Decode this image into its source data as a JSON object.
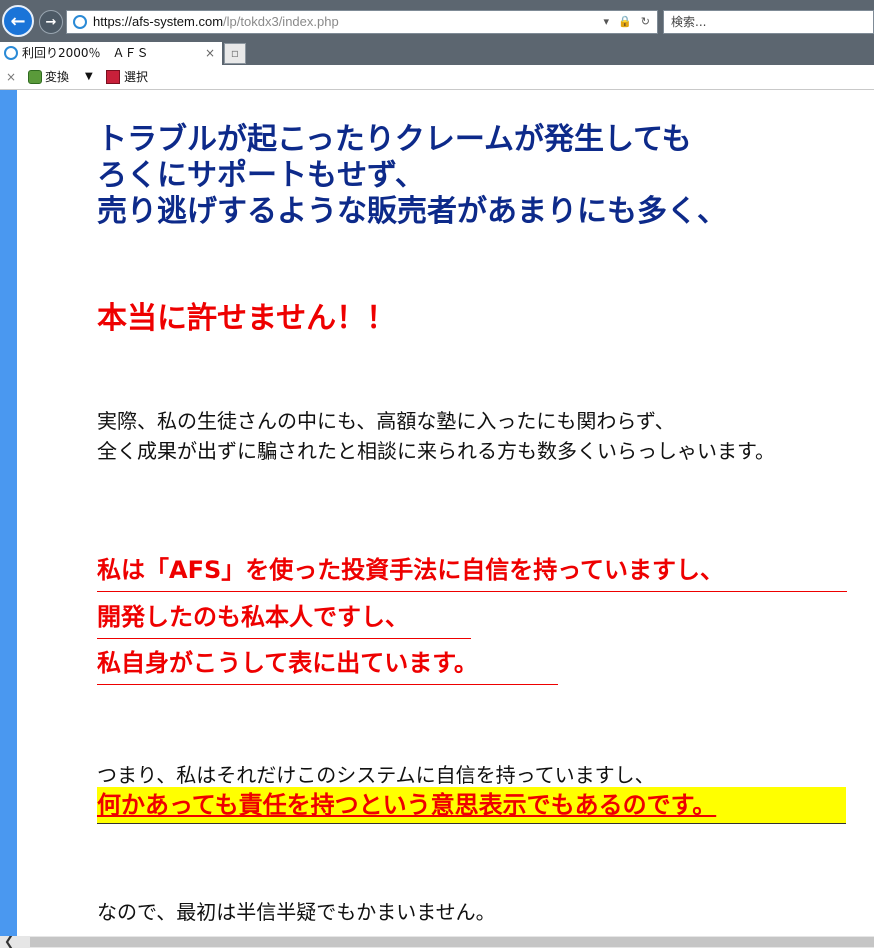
{
  "browser": {
    "url_host": "https://afs-system.com",
    "url_path": "/lp/tokdx3/index.php",
    "url_tools": "▾ 🔒 ↻",
    "search_placeholder": "検索...",
    "tab_title": "利回り2000％　ＡＦＳ",
    "tab_close": "×",
    "new_tab": "▫"
  },
  "toolbar": {
    "close": "×",
    "convert_label": "変換",
    "dropdown": "▼",
    "select_label": "選択"
  },
  "page": {
    "heading_lines": [
      "トラブルが起こったりクレームが発生しても",
      "ろくにサポートもせず、",
      "売り逃げするような販売者があまりにも多く、"
    ],
    "callout": "本当に許せません！！",
    "paragraph1": [
      "実際、私の生徒さんの中にも、高額な塾に入ったにも関わらず、",
      "全く成果が出ずに騙されたと相談に来られる方も数多くいらっしゃいます。"
    ],
    "red_lines": [
      "私は「AFS」を使った投資手法に自信を持っていますし、",
      "開発したのも私本人ですし、",
      "私自身がこうして表に出ています。"
    ],
    "paragraph2": "つまり、私はそれだけこのシステムに自信を持っていますし、",
    "highlight": "何かあっても責任を持つという意思表示でもあるのです。",
    "paragraph3": "なので、最初は半信半疑でもかまいません。"
  },
  "colors": {
    "heading": "#0d2a8a",
    "emphasis_red": "#ee0000",
    "highlight_bg": "#ffff00",
    "left_strip": "#4a98f0"
  }
}
